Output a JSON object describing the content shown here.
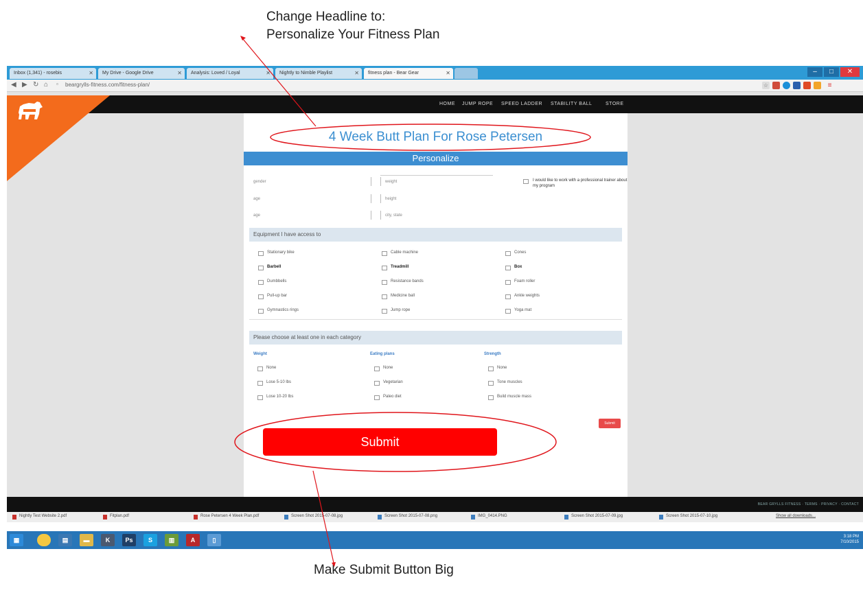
{
  "annotations": {
    "headline_note_line1": "Change Headline to:",
    "headline_note_line2": "Personalize Your Fitness Plan",
    "submit_note": "Make Submit Button Big"
  },
  "browser": {
    "tabs": [
      {
        "label": "Inbox (1,341) - rosebis"
      },
      {
        "label": "My Drive - Google Drive"
      },
      {
        "label": "Analysis: Loved / Loyal"
      },
      {
        "label": "Nightly to Nimble Playlist"
      },
      {
        "label": "fitness plan - Bear Gear"
      }
    ],
    "url": "beargrylls-fitness.com/fitness-plan/",
    "window_controls": [
      "–",
      "□",
      "✕"
    ]
  },
  "site": {
    "menu": [
      "HOME",
      "JUMP ROPE",
      "SPEED LADDER",
      "STABILITY BALL",
      "STORE"
    ],
    "headline": "4 Week Butt Plan For Rose Petersen",
    "personalize_bar": "Personalize",
    "fields_left": [
      "gender",
      "age",
      "age"
    ],
    "fields_right": [
      "weight",
      "height",
      "city, state"
    ],
    "pro_checkbox_text": "I would like to work with a professional trainer about my program",
    "equipment_header": "Equipment I have access to",
    "equipment": [
      [
        "Stationary bike",
        "Cable machine",
        "Cones"
      ],
      [
        "Barbell",
        "Treadmill",
        "Box"
      ],
      [
        "Dumbbells",
        "Resistance bands",
        "Foam roller"
      ],
      [
        "Pull-up bar",
        "Medicine ball",
        "Ankle weights"
      ],
      [
        "Gymnastics rings",
        "Jump rope",
        "Yoga mat"
      ]
    ],
    "goals_header": "Please choose at least one in each category",
    "goal_columns": [
      {
        "title": "Weight",
        "options": [
          "None",
          "Lose 5-10 lbs",
          "Lose 10-20 lbs"
        ]
      },
      {
        "title": "Eating plans",
        "options": [
          "None",
          "Vegetarian",
          "Paleo diet"
        ]
      },
      {
        "title": "Strength",
        "options": [
          "None",
          "Tone muscles",
          "Build muscle mass"
        ]
      }
    ],
    "small_button": "Submit",
    "submit_label": "Submit",
    "footer_text": "BEAR GRYLLS FITNESS · TERMS · PRIVACY · CONTACT"
  },
  "downloads": [
    "Nightly Test Website 2.pdf",
    "Fitplan.pdf",
    "Rose Petersen 4 Week Plan.pdf",
    "Screen Shot 2015-07-08.jpg",
    "Screen Shot 2015-07-08.png",
    "IMG_0414.PNG",
    "Screen Shot 2015-07-09.jpg",
    "Screen Shot 2015-07-10.jpg"
  ],
  "downloads_link": "Show all downloads...",
  "taskbar": {
    "clock_time": "3:18 PM",
    "clock_date": "7/10/2015"
  },
  "colors": {
    "accent_blue": "#3d8ed1",
    "brand_orange": "#f36b1c",
    "submit_red": "#ff0000",
    "annotation_red": "#e0151b"
  }
}
